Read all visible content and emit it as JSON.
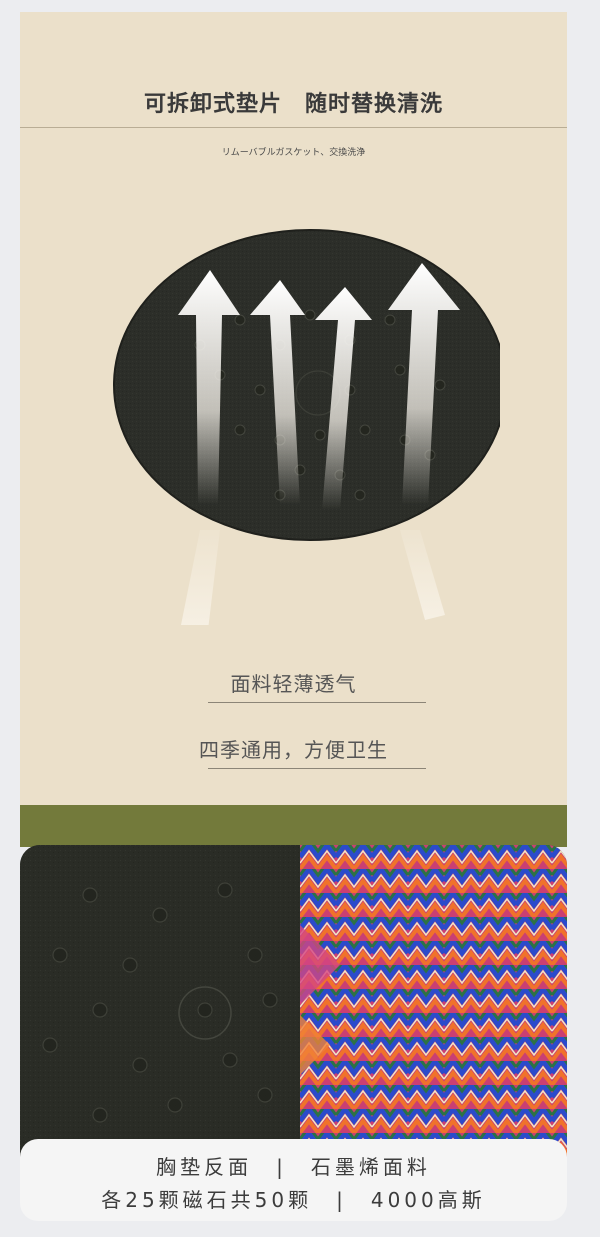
{
  "header": {
    "title": "可拆卸式垫片　随时替换清洗",
    "subtitle": "リムーバブルガスケット、交換洗浄"
  },
  "features": [
    "面料轻薄透气",
    "四季通用，方便卫生"
  ],
  "caption": {
    "line1": "胸垫反面　|　石墨烯面料",
    "line2": "各25颗磁石共50颗　|　4000高斯"
  },
  "colors": {
    "panel_beige": "#ebe0ca",
    "band_olive": "#737a3b",
    "pad_dark": "#2c2e29"
  },
  "icons": [
    "airflow-arrow-icon",
    "magnet-dot-icon"
  ]
}
